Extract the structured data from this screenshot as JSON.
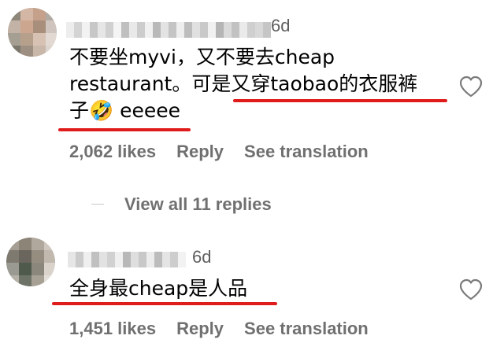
{
  "comments": [
    {
      "time": "6d",
      "lines": [
        "不要坐myvi，又不要去cheap",
        "restaurant。可是又穿taobao的衣服裤",
        "子🤣 eeeee"
      ],
      "likes": "2,062 likes",
      "reply": "Reply",
      "translate": "See translation"
    },
    {
      "time": "6d",
      "lines": [
        "全身最cheap是人品"
      ],
      "likes": "1,451 likes",
      "reply": "Reply",
      "translate": "See translation"
    }
  ],
  "view_replies": "View all 11 replies",
  "icons": {
    "heart": "heart-outline-icon"
  },
  "colors": {
    "highlight": "#e01b1b",
    "meta": "#707070"
  }
}
